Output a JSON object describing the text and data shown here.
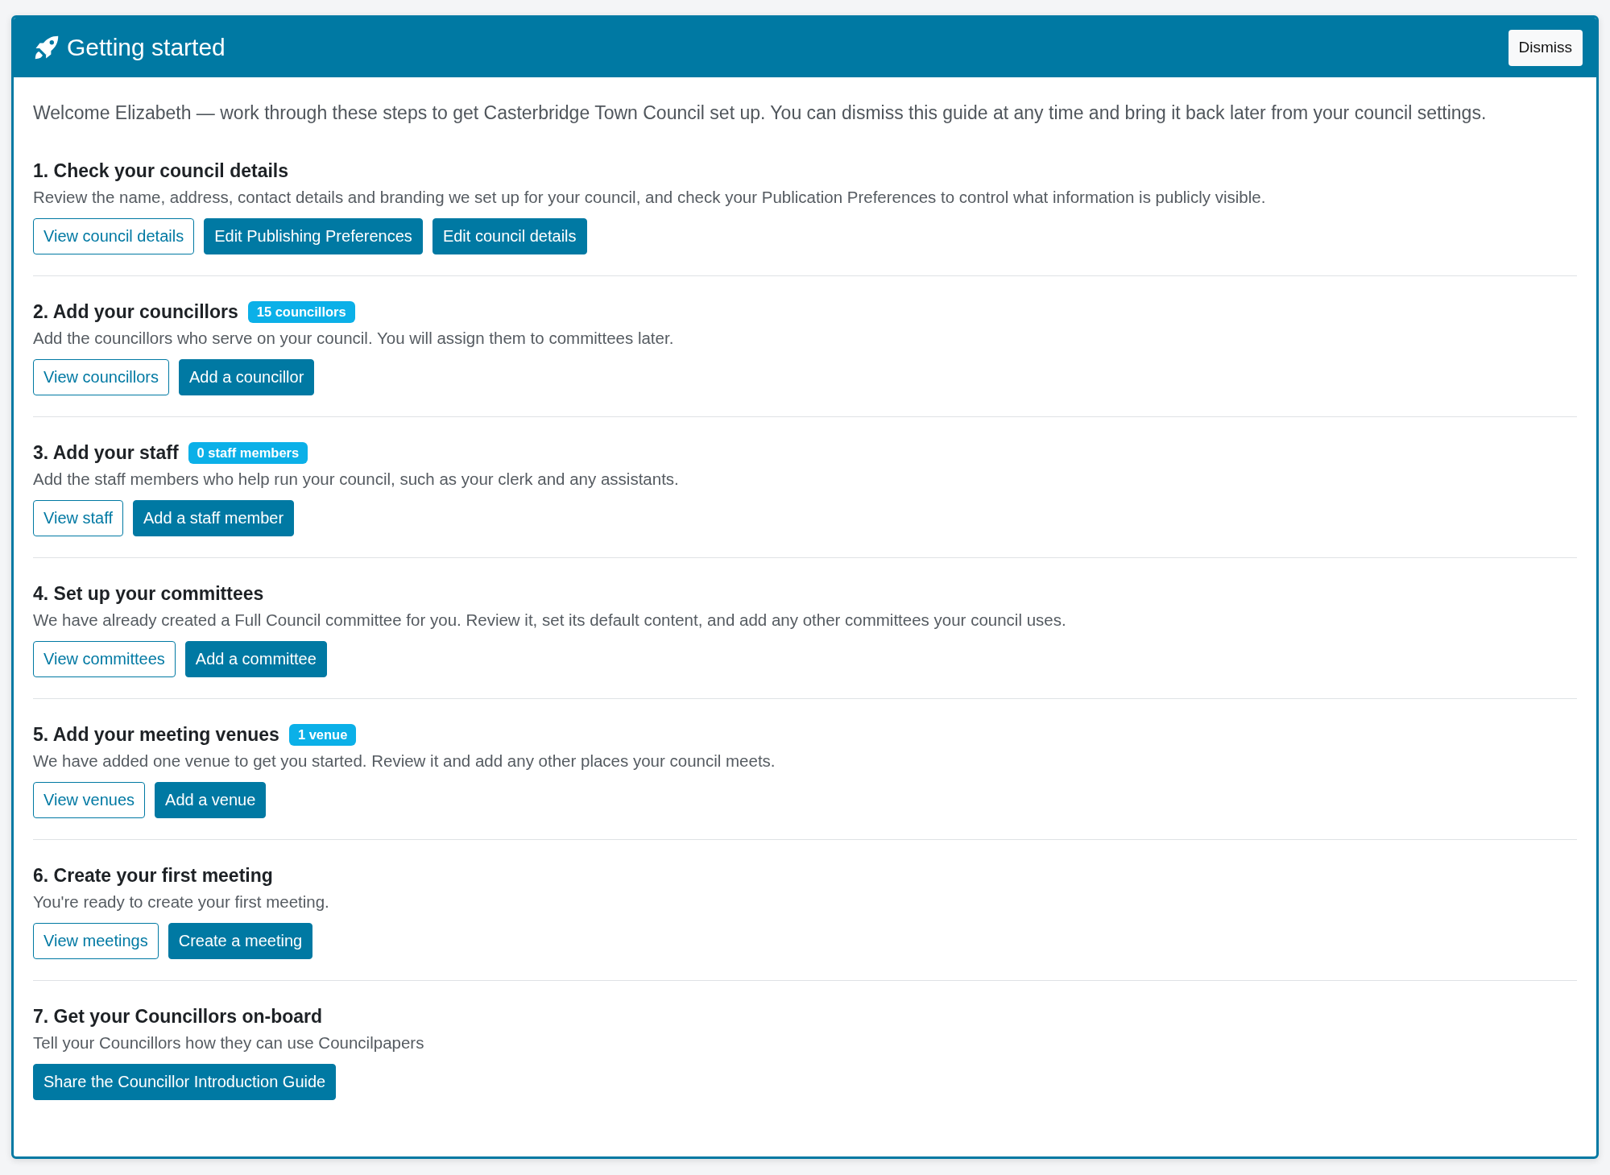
{
  "header": {
    "title": "Getting started",
    "dismiss_button": "Dismiss"
  },
  "intro": "Welcome Elizabeth — work through these steps to get Casterbridge Town Council set up. You can dismiss this guide at any time and bring it back later from your council settings.",
  "steps": [
    {
      "heading": "1. Check your council details",
      "description": "Review the name, address, contact details and branding we set up for your council, and check your Publication Preferences to control what information is publicly visible.",
      "buttons": [
        {
          "label": "View council details",
          "kind": "outline"
        },
        {
          "label": "Edit Publishing Preferences",
          "kind": "primary"
        },
        {
          "label": "Edit council details",
          "kind": "primary"
        }
      ]
    },
    {
      "heading": "2. Add your councillors",
      "badge": "15 councillors",
      "description": "Add the councillors who serve on your council. You will assign them to committees later.",
      "buttons": [
        {
          "label": "View councillors",
          "kind": "outline"
        },
        {
          "label": "Add a councillor",
          "kind": "primary"
        }
      ]
    },
    {
      "heading": "3. Add your staff",
      "badge": "0 staff members",
      "description": "Add the staff members who help run your council, such as your clerk and any assistants.",
      "buttons": [
        {
          "label": "View staff",
          "kind": "outline"
        },
        {
          "label": "Add a staff member",
          "kind": "primary"
        }
      ]
    },
    {
      "heading": "4. Set up your committees",
      "description": "We have already created a Full Council committee for you. Review it, set its default content, and add any other committees your council uses.",
      "buttons": [
        {
          "label": "View committees",
          "kind": "outline"
        },
        {
          "label": "Add a committee",
          "kind": "primary"
        }
      ]
    },
    {
      "heading": "5. Add your meeting venues",
      "badge": "1 venue",
      "description": "We have added one venue to get you started. Review it and add any other places your council meets.",
      "buttons": [
        {
          "label": "View venues",
          "kind": "outline"
        },
        {
          "label": "Add a venue",
          "kind": "primary"
        }
      ]
    },
    {
      "heading": "6. Create your first meeting",
      "description": "You're ready to create your first meeting.",
      "buttons": [
        {
          "label": "View meetings",
          "kind": "outline"
        },
        {
          "label": "Create a meeting",
          "kind": "primary"
        }
      ]
    },
    {
      "heading": "7. Get your Councillors on-board",
      "description": "Tell your Councillors how they can use Councilpapers",
      "buttons": [
        {
          "label": "Share the Councillor Introduction Guide",
          "kind": "primary"
        }
      ]
    }
  ]
}
